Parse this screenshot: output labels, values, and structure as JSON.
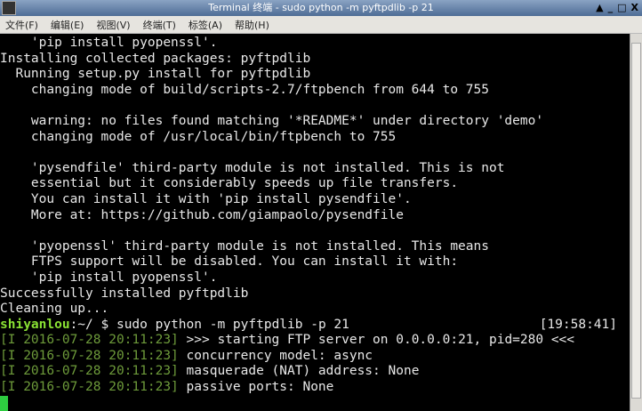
{
  "window": {
    "title": "Terminal 终端 - sudo python -m pyftpdlib -p 21",
    "buttons": [
      "▲",
      "_",
      "□",
      "X"
    ]
  },
  "menu": [
    "文件(F)",
    "编辑(E)",
    "视图(V)",
    "终端(T)",
    "标签(A)",
    "帮助(H)"
  ],
  "output": [
    "    'pip install pyopenssl'.",
    "Installing collected packages: pyftpdlib",
    "  Running setup.py install for pyftpdlib",
    "    changing mode of build/scripts-2.7/ftpbench from 644 to 755",
    "",
    "    warning: no files found matching '*README*' under directory 'demo'",
    "    changing mode of /usr/local/bin/ftpbench to 755",
    "",
    "    'pysendfile' third-party module is not installed. This is not",
    "    essential but it considerably speeds up file transfers.",
    "    You can install it with 'pip install pysendfile'.",
    "    More at: https://github.com/giampaolo/pysendfile",
    "",
    "    'pyopenssl' third-party module is not installed. This means",
    "    FTPS support will be disabled. You can install it with:",
    "    'pip install pyopenssl'.",
    "Successfully installed pyftpdlib",
    "Cleaning up..."
  ],
  "prompt": {
    "user": "shiyanlou",
    "path": ":~/ $ ",
    "command": "sudo python -m pyftpdlib -p 21",
    "time": "[19:58:41]"
  },
  "log": [
    {
      "ts": "[I 2016-07-28 20:11:23]",
      "msg": " >>> starting FTP server on 0.0.0.0:21, pid=280 <<<"
    },
    {
      "ts": "[I 2016-07-28 20:11:23]",
      "msg": " concurrency model: async"
    },
    {
      "ts": "[I 2016-07-28 20:11:23]",
      "msg": " masquerade (NAT) address: None"
    },
    {
      "ts": "[I 2016-07-28 20:11:23]",
      "msg": " passive ports: None"
    }
  ]
}
